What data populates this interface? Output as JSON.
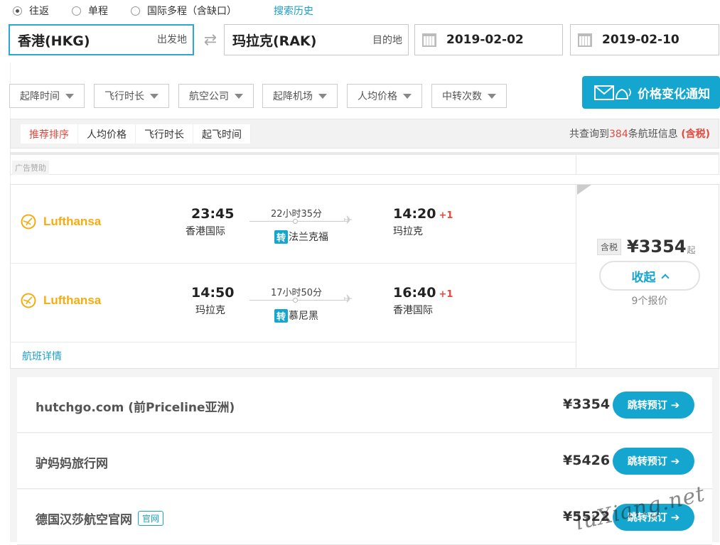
{
  "trip_type": {
    "options": [
      {
        "label": "往返",
        "checked": true
      },
      {
        "label": "单程",
        "checked": false
      },
      {
        "label": "国际多程（含缺口）",
        "checked": false
      }
    ],
    "history_link": "搜索历史"
  },
  "search": {
    "origin": {
      "value": "香港(HKG)",
      "hint": "出发地"
    },
    "destination": {
      "value": "玛拉克(RAK)",
      "hint": "目的地"
    },
    "depart_date": "2019-02-02",
    "return_date": "2019-02-10",
    "swap_icon": "swap-arrows-icon"
  },
  "filters": [
    "起降时间",
    "飞行时长",
    "航空公司",
    "起降机场",
    "人均价格",
    "中转次数"
  ],
  "notify_button": {
    "label": "价格变化通知",
    "icon": "mail-bell-icon"
  },
  "sort": {
    "tabs": [
      {
        "label": "推荐排序",
        "active": true
      },
      {
        "label": "人均价格",
        "active": false
      },
      {
        "label": "飞行时长",
        "active": false
      },
      {
        "label": "起飞时间",
        "active": false
      }
    ],
    "count_prefix": "共查询到",
    "count": "384",
    "count_suffix": "条航班信息 ",
    "tax_note": "(含税)"
  },
  "ad_label": "广告赞助",
  "flight": {
    "legs": [
      {
        "airline": "Lufthansa",
        "dep_time": "23:45",
        "dep_place": "香港国际",
        "duration": "22小时35分",
        "transfer_badge": "转",
        "transfer_city": "法兰克福",
        "arr_time": "14:20",
        "arr_plus": "+1",
        "arr_place": "玛拉克"
      },
      {
        "airline": "Lufthansa",
        "dep_time": "14:50",
        "dep_place": "玛拉克",
        "duration": "17小时50分",
        "transfer_badge": "转",
        "transfer_city": "慕尼黑",
        "arr_time": "16:40",
        "arr_plus": "+1",
        "arr_place": "香港国际"
      }
    ],
    "detail_link": "航班详情",
    "tax_tag": "含税",
    "price": "¥3354",
    "price_suffix": "起",
    "collapse_label": "收起",
    "quotes": "9个报价"
  },
  "vendors": [
    {
      "name": "hutchgo.com (前Priceline亚洲)",
      "official": "",
      "price": "¥3354",
      "button": "跳转预订"
    },
    {
      "name": "驴妈妈旅行网",
      "official": "",
      "price": "¥5426",
      "button": "跳转预订"
    },
    {
      "name": "德国汉莎航空官网",
      "official": "官网",
      "price": "¥5522",
      "button": "跳转预订"
    }
  ],
  "watermark": "luXiang.net",
  "colors": {
    "accent": "#14a6cf",
    "highlight": "#e6483d",
    "airline_brand": "#f4ad10"
  }
}
